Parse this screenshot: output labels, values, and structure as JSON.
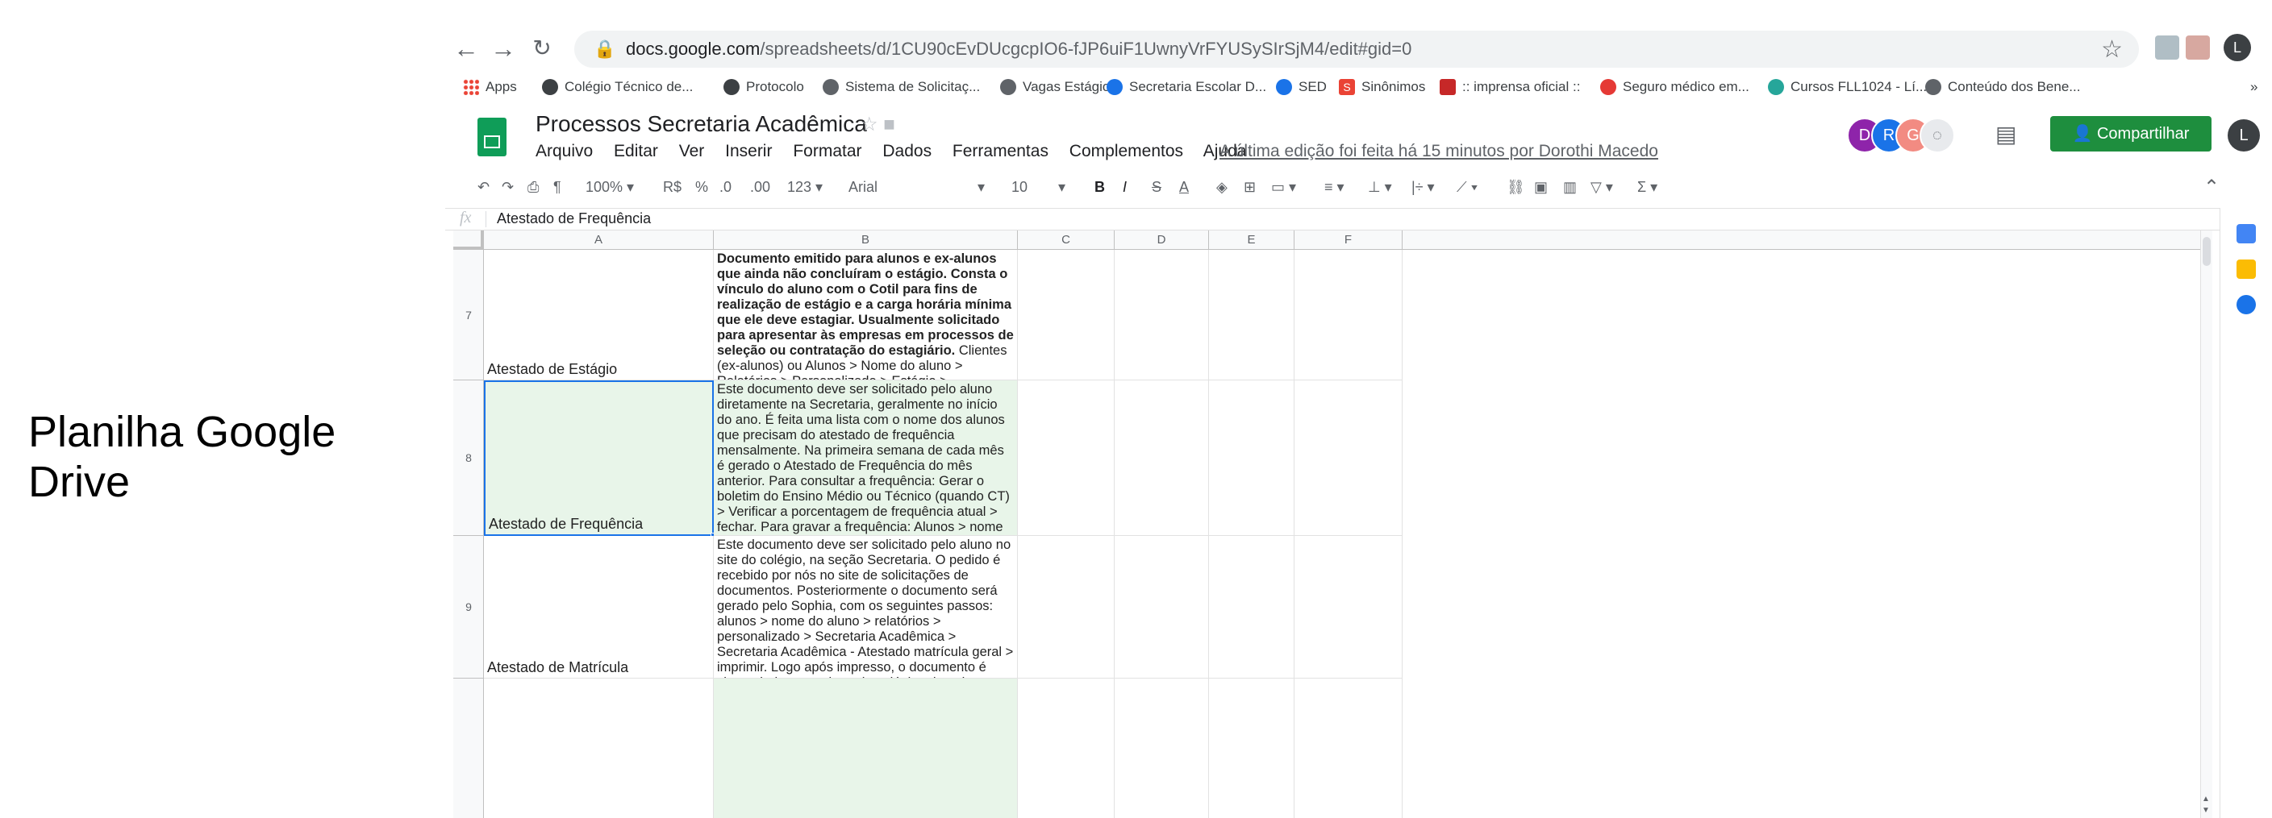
{
  "caption": "Planilha Google Drive",
  "browser": {
    "url_host": "docs.google.com",
    "url_path": "/spreadsheets/d/1CU90cEvDUcgcpIO6-fJP6uiF1UwnyVrFYUSySIrSjM4/edit#gid=0",
    "profile_initial": "L"
  },
  "bookmarks": [
    {
      "label": "Apps"
    },
    {
      "label": "Colégio Técnico de..."
    },
    {
      "label": "Protocolo"
    },
    {
      "label": "Sistema de Solicitaç..."
    },
    {
      "label": "Vagas Estágio"
    },
    {
      "label": "Secretaria Escolar D..."
    },
    {
      "label": "SED"
    },
    {
      "label": "Sinônimos"
    },
    {
      "label": ":: imprensa oficial ::"
    },
    {
      "label": "Seguro médico em..."
    },
    {
      "label": "Cursos FLL1024 - Lí..."
    },
    {
      "label": "Conteúdo dos Bene..."
    },
    {
      "label": "»"
    }
  ],
  "sheets": {
    "title": "Processos Secretaria Acadêmica",
    "menu": [
      "Arquivo",
      "Editar",
      "Ver",
      "Inserir",
      "Formatar",
      "Dados",
      "Ferramentas",
      "Complementos",
      "Ajuda"
    ],
    "last_edit": "A última edição foi feita há 15 minutos por Dorothi Macedo",
    "share_label": "Compartilhar",
    "avatars": [
      {
        "initial": "D",
        "color": "#8e24aa"
      },
      {
        "initial": "R",
        "color": "#1a73e8"
      },
      {
        "initial": "G",
        "color": "#f28b82"
      }
    ],
    "user_initial": "L"
  },
  "toolbar": {
    "zoom": "100%",
    "currency": "R$",
    "percent": "%",
    "dec_less": ".0",
    "dec_more": ".00",
    "format": "123",
    "font": "Arial",
    "size": "10"
  },
  "formula_bar": {
    "fx": "fx",
    "value": "Atestado de Frequência"
  },
  "columns": [
    "A",
    "B",
    "C",
    "D",
    "E",
    "F"
  ],
  "rows": [
    {
      "num": "7",
      "a": "Atestado de Estágio",
      "b_bold": "Documento emitido para alunos e ex-alunos que ainda não concluíram o estágio. Consta o vínculo do aluno com o Cotil para fins de realização de estágio e a carga horária mínima que ele deve estagiar. Usualmente solicitado para apresentar às empresas em processos de seleção ou contratação do estagiário.",
      "b_normal": " Clientes (ex-alunos) ou Alunos > Nome do aluno > Relatórios > Personalizado > Estágio > Selecionar Estágio - Atestado (selecionar conforme curso e carga horária) > Imprimir > Selecionar o curso. Técnico > Confirmar > Imprimir."
    },
    {
      "num": "8",
      "a": "Atestado de Frequência",
      "b_bold": "",
      "b_normal": "Este documento deve ser solicitado pelo aluno diretamente na Secretaria, geralmente no início do ano. É feita uma lista com o nome dos alunos que precisam do atestado de frequência mensalmente. Na primeira semana de cada mês é gerado o Atestado de Frequência do mês anterior. Para consultar a frequência: Gerar o boletim do Ensino Médio ou Técnico (quando CT) > Verificar a porcentagem de frequência atual > fechar. Para gravar a frequência: Alunos > nome do aluno > Dados Cadastrais > Dados Complementares > Preencher mês da frequência > Preencher porcentagem da frequência > Gravar. Para gerar o Atestado de Frequência: Alunos > nome do aluno > relatórios > personalizado > Secretaria Acadêmica > Secretaria Acadêmica - Atestado de frequência > imprimir. Logo após impresso, o documento é chancelado com o logo do colégio e levado para assinatura do diretor responsável. O documento será guardado na gaveta \"DOCUMENTOS SOLICITADOS EX- ALUNOS\", que estará organizada por ordem alfabética."
    },
    {
      "num": "9",
      "a": "Atestado de Matrícula",
      "b_bold": "",
      "b_normal": "Este documento deve ser solicitado pelo aluno no site do colégio, na seção Secretaria. O pedido é recebido por nós no site de solicitações de documentos. Posteriormente o documento será gerado pelo Sophia, com os seguintes passos: alunos > nome do aluno > relatórios > personalizado > Secretaria Acadêmica > Secretaria Acadêmica - Atestado matrícula geral > imprimir. Logo após impresso, o documento é chancelado com o logo do colégio e levado para assinatura do diretor responsável. Nesta etapa, conclui-se o documento no site de solicitações. Quando assinado, devemos avisar o solicitante pelo site e finalizar o pedido. o documento será guardado na gaveta \"DOCUMENTOS SOLICITADOS EX- ALUNOS\", que estará organizada por ordem alfabética."
    }
  ]
}
